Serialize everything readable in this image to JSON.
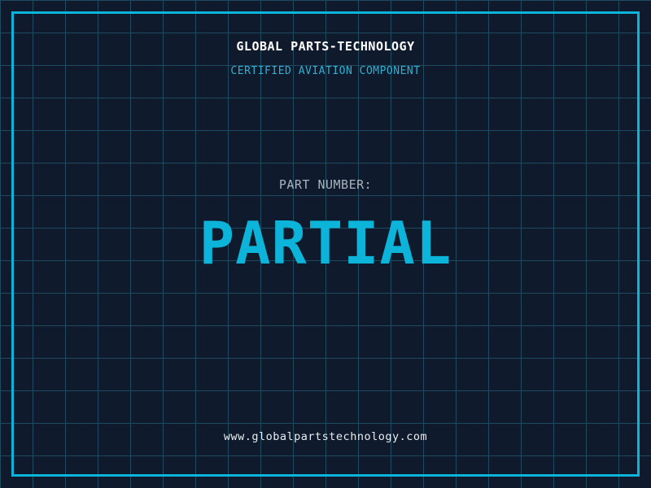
{
  "page": {
    "background_color": "#0f1a2d",
    "grid_color": "#1e4b5f",
    "grid_spacing_px": 40,
    "frame_color": "#0db4d9",
    "accent_cyan": "#0db4d9"
  },
  "header": {
    "title": "GLOBAL PARTS-TECHNOLOGY",
    "title_color": "#ffffff",
    "subtitle": "CERTIFIED AVIATION COMPONENT",
    "subtitle_color": "#2fb0d2"
  },
  "part": {
    "label": "PART NUMBER:",
    "label_color": "#aab4be",
    "value": "PARTIAL",
    "value_color": "#0db4d9"
  },
  "footer": {
    "website": "www.globalpartstechnology.com",
    "website_color": "#e9edf0"
  }
}
